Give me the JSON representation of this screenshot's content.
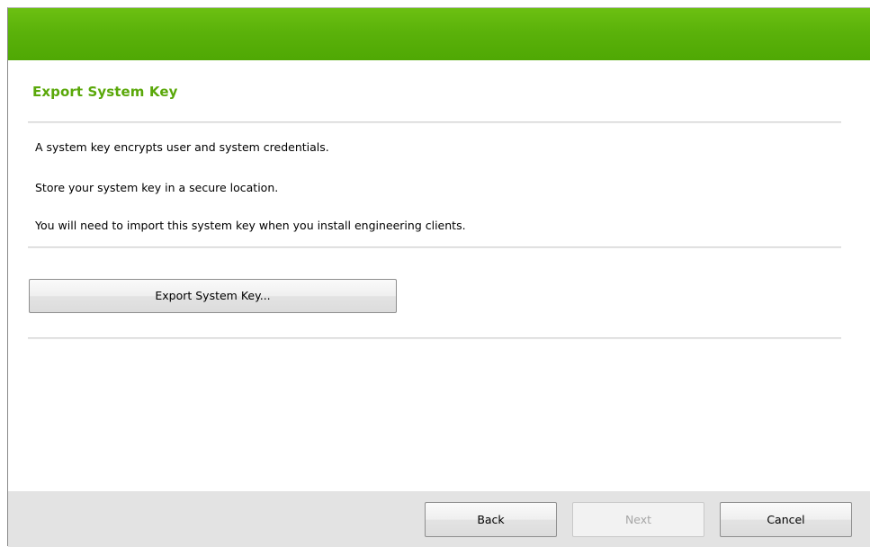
{
  "page": {
    "title": "Export System Key",
    "paragraphs": [
      "A system key encrypts user and system credentials.",
      "Store your system key in a secure location.",
      "You will need to import this system key when you install engineering clients."
    ],
    "export_button": "Export System Key..."
  },
  "footer": {
    "back_label": "Back",
    "next_label": "Next",
    "cancel_label": "Cancel",
    "next_enabled": false
  },
  "colors": {
    "banner_green": "#5bb20a",
    "title_green": "#5aa80a",
    "footer_gray": "#e3e3e3"
  }
}
